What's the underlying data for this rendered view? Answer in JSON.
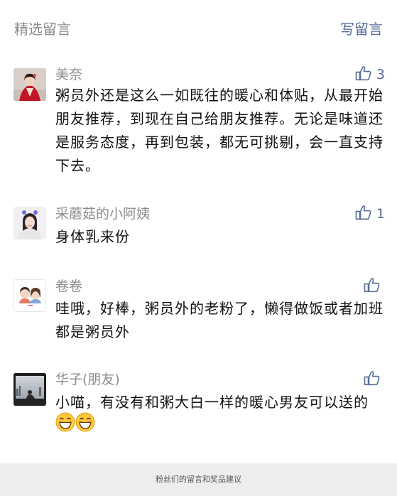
{
  "header": {
    "title": "精选留言",
    "write_label": "写留言"
  },
  "comments": [
    {
      "name": "美奈",
      "likes": "3",
      "text": "粥员外还是这么一如既往的暖心和体贴，从最开始朋友推荐，到现在自己给朋友推荐。无论是味道还是服务态度，再到包装，都无可挑剔，会一直支持下去。"
    },
    {
      "name": "采蘑菇的小阿姨",
      "likes": "1",
      "text": "身体乳来份"
    },
    {
      "name": "卷卷",
      "likes": "",
      "text": "哇哦，好棒，粥员外的老粉了，懒得做饭或者加班都是粥员外"
    },
    {
      "name": "华子(朋友)",
      "likes": "",
      "text": "小喵，有没有和粥大白一样的暖心男友可以送的",
      "emojis": [
        "grinning-face",
        "grinning-face"
      ]
    }
  ],
  "footer": {
    "caption": "粉丝们的留言和奖品建议"
  },
  "colors": {
    "link": "#576b95",
    "muted": "#8c8c8c",
    "text": "#111111",
    "page_bg": "#ededed"
  }
}
